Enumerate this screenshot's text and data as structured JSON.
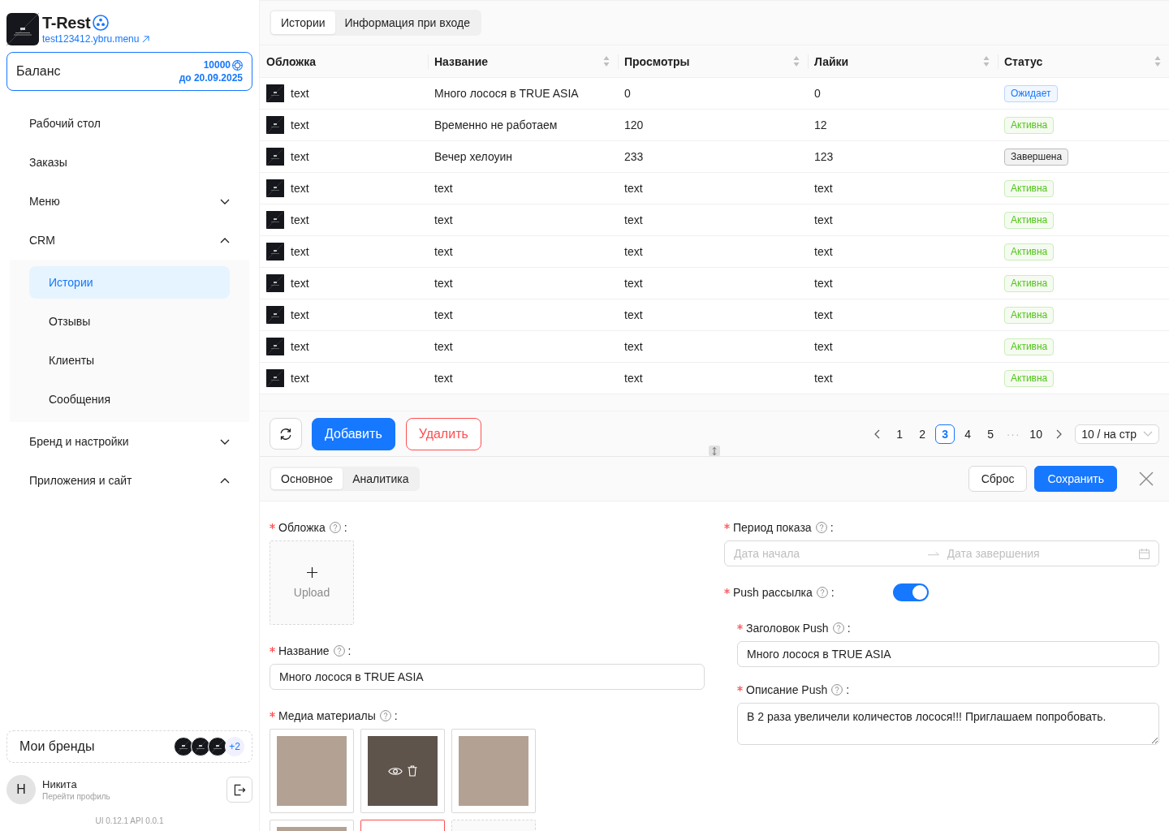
{
  "sidebar": {
    "brand": {
      "name": "T-Rest",
      "link": "test123412.ybru.menu"
    },
    "balance": {
      "label": "Баланс",
      "amount": "10000",
      "until": "до 20.09.2025"
    },
    "menu": [
      {
        "label": "Рабочий стол",
        "kind": "link",
        "selected": false
      },
      {
        "label": "Заказы",
        "kind": "link",
        "selected": false
      },
      {
        "label": "Меню",
        "kind": "group",
        "selected": false,
        "expanded": false
      },
      {
        "label": "CRM",
        "kind": "group",
        "selected": false,
        "expanded": true,
        "children": [
          {
            "label": "Истории",
            "selected": true
          },
          {
            "label": "Отзывы",
            "selected": false
          },
          {
            "label": "Клиенты",
            "selected": false
          },
          {
            "label": "Сообщения",
            "selected": false
          }
        ]
      },
      {
        "label": "Бренд и настройки",
        "kind": "group",
        "selected": false,
        "expanded": false
      },
      {
        "label": "Приложения и сайт",
        "kind": "group",
        "selected": false,
        "expanded": true
      }
    ],
    "brands": {
      "label": "Мои бренды",
      "more": "+2"
    },
    "profile": {
      "initial": "Н",
      "name": "Никита",
      "hint": "Перейти профиль"
    },
    "version": "UI 0.12.1 API 0.0.1"
  },
  "tabs": [
    {
      "label": "Истории",
      "selected": true
    },
    {
      "label": "Информация при входе",
      "selected": false
    }
  ],
  "table": {
    "columns": [
      {
        "label": "Обложка",
        "sortable": false
      },
      {
        "label": "Название",
        "sortable": true
      },
      {
        "label": "Просмотры",
        "sortable": true
      },
      {
        "label": "Лайки",
        "sortable": true
      },
      {
        "label": "Статус",
        "sortable": true
      }
    ],
    "rows": [
      {
        "cover": "text",
        "name": "Много лосося в TRUE ASIA",
        "views": "0",
        "likes": "0",
        "status": "Ожидает",
        "color": "#1677ff"
      },
      {
        "cover": "text",
        "name": "Временно не работаем",
        "views": "120",
        "likes": "12",
        "status": "Активна",
        "color": "#52c41a"
      },
      {
        "cover": "text",
        "name": "Вечер хелоуин",
        "views": "233",
        "likes": "123",
        "status": "Завершена",
        "color": "#1f1f1f"
      },
      {
        "cover": "text",
        "name": "text",
        "views": "text",
        "likes": "text",
        "status": "Активна",
        "color": "#52c41a"
      },
      {
        "cover": "text",
        "name": "text",
        "views": "text",
        "likes": "text",
        "status": "Активна",
        "color": "#52c41a"
      },
      {
        "cover": "text",
        "name": "text",
        "views": "text",
        "likes": "text",
        "status": "Активна",
        "color": "#52c41a"
      },
      {
        "cover": "text",
        "name": "text",
        "views": "text",
        "likes": "text",
        "status": "Активна",
        "color": "#52c41a"
      },
      {
        "cover": "text",
        "name": "text",
        "views": "text",
        "likes": "text",
        "status": "Активна",
        "color": "#52c41a"
      },
      {
        "cover": "text",
        "name": "text",
        "views": "text",
        "likes": "text",
        "status": "Активна",
        "color": "#52c41a"
      },
      {
        "cover": "text",
        "name": "text",
        "views": "text",
        "likes": "text",
        "status": "Активна",
        "color": "#52c41a"
      }
    ]
  },
  "toolbar": {
    "add": "Добавить",
    "delete": "Удалить"
  },
  "pagination": {
    "pages": [
      {
        "label": "1",
        "kind": "page",
        "selected": false
      },
      {
        "label": "2",
        "kind": "page",
        "selected": false
      },
      {
        "label": "3",
        "kind": "page",
        "selected": true
      },
      {
        "label": "4",
        "kind": "page",
        "selected": false
      },
      {
        "label": "5",
        "kind": "page",
        "selected": false
      },
      {
        "label": "···",
        "kind": "ellipsis"
      },
      {
        "label": "10",
        "kind": "page",
        "selected": false
      }
    ],
    "page_size": "10 / на стр"
  },
  "editor": {
    "tabs": [
      {
        "label": "Основное",
        "selected": true
      },
      {
        "label": "Аналитика",
        "selected": false
      }
    ],
    "reset": "Сброс",
    "save": "Сохранить",
    "left": [
      {
        "kind": "upload",
        "label": "Обложка",
        "suffix": ":",
        "required": true,
        "upload_text": "Upload"
      },
      {
        "kind": "input",
        "label": "Название",
        "suffix": ":",
        "required": true,
        "value": "Много лосося в TRUE ASIA"
      },
      {
        "kind": "media",
        "label": "Медиа материалы",
        "suffix": ":",
        "required": true,
        "items": [
          {
            "kind": "image",
            "hovered": false
          },
          {
            "kind": "image",
            "hovered": true
          },
          {
            "kind": "image",
            "hovered": false
          },
          {
            "kind": "image",
            "hovered": false
          },
          {
            "kind": "error"
          },
          {
            "kind": "upload"
          }
        ]
      }
    ],
    "right": [
      {
        "kind": "daterange",
        "label": "Период показа",
        "suffix": ":",
        "required": true,
        "start_placeholder": "Дата начала",
        "end_placeholder": "Дата завершения"
      },
      {
        "kind": "switch",
        "label": "Push рассылка",
        "suffix": ":",
        "required": true,
        "on": true,
        "children": [
          {
            "kind": "input",
            "label": "Заголовок Push",
            "suffix": ":",
            "required": true,
            "value": "Много лосося в TRUE ASIA"
          },
          {
            "kind": "textarea",
            "label": "Описание Push",
            "suffix": ":",
            "required": true,
            "value": "В 2 раза увеличели количестов лосося!!! Приглашаем попробовать."
          }
        ]
      }
    ]
  }
}
